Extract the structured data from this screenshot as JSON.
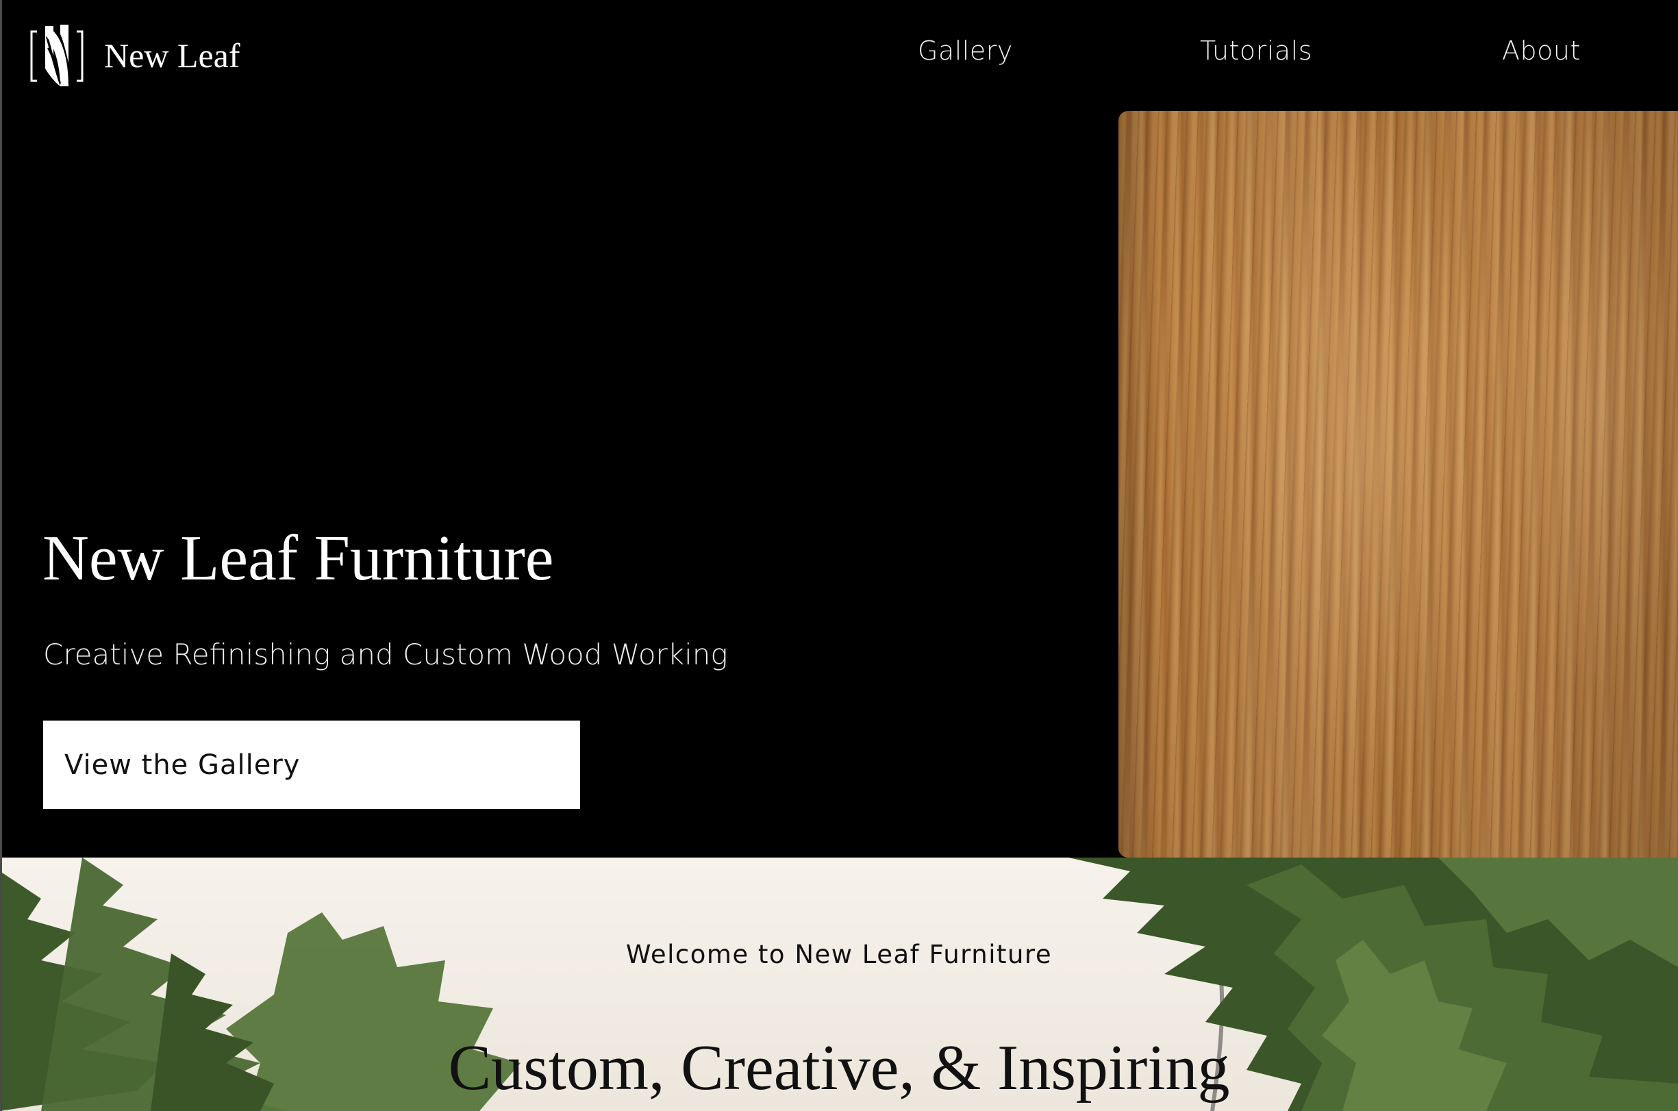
{
  "header": {
    "logo_text": "New Leaf",
    "nav": [
      {
        "label": "Gallery"
      },
      {
        "label": "Tutorials"
      },
      {
        "label": "About"
      }
    ]
  },
  "hero": {
    "title": "New Leaf Furniture",
    "subtitle": "Creative Refinishing and Custom Wood Working",
    "cta_label": "View the Gallery",
    "image": "wood-grain-panel"
  },
  "welcome": {
    "kicker": "Welcome to New Leaf Furniture",
    "heading": "Custom, Creative, & Inspiring",
    "background_image": "evergreen-trees"
  },
  "colors": {
    "background": "#000000",
    "text_light": "#ffffff",
    "button_bg": "#ffffff",
    "button_text": "#111111",
    "wood": "#b37840",
    "welcome_bg": "#f3eee6",
    "tree_green": "#3f5a2c"
  }
}
